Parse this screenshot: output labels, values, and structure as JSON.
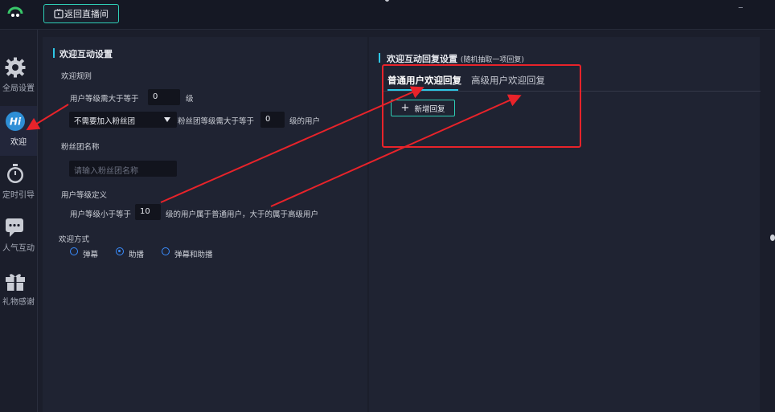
{
  "topbar": {
    "back_label": "返回直播间",
    "minimize_glyph": "–"
  },
  "sidebar": {
    "items": [
      {
        "label": "全局设置",
        "icon": "gear-icon"
      },
      {
        "label": "欢迎",
        "icon": "hi-icon"
      },
      {
        "label": "定时引导",
        "icon": "timer-icon"
      },
      {
        "label": "人气互动",
        "icon": "chat-icon"
      },
      {
        "label": "礼物感谢",
        "icon": "gift-icon"
      }
    ],
    "active_index": 1
  },
  "left_panel": {
    "title": "欢迎互动设置",
    "welcome_rules": {
      "heading": "欢迎规则",
      "level_label": "用户等级需大于等于",
      "level_value": "0",
      "level_suffix": "级",
      "fan_group_select": "不需要加入粉丝团",
      "fan_level_label": "粉丝团等级需大于等于",
      "fan_level_value": "0",
      "fan_level_suffix": "级的用户"
    },
    "fan_group_name": {
      "heading": "粉丝团名称",
      "placeholder": "请输入粉丝团名称"
    },
    "user_level_def": {
      "heading": "用户等级定义",
      "prefix": "用户等级小于等于",
      "value": "10",
      "suffix": "级的用户属于普通用户，大于的属于高级用户"
    },
    "welcome_method": {
      "heading": "欢迎方式",
      "options": [
        "弹幕",
        "助播",
        "弹幕和助播"
      ],
      "selected_index": 1
    }
  },
  "right_panel": {
    "title": "欢迎互动回复设置",
    "title_note": "(随机抽取一项回复)",
    "tabs": [
      {
        "label": "普通用户欢迎回复",
        "active": true
      },
      {
        "label": "高级用户欢迎回复",
        "active": false
      }
    ],
    "add_button": "新增回复"
  },
  "colors": {
    "accent": "#2ec7e6",
    "border_accent": "#2ecfb7",
    "radio": "#3a8dff",
    "annotation": "#e8232a",
    "background": "#1b1e2b",
    "panel": "#1f2332"
  }
}
